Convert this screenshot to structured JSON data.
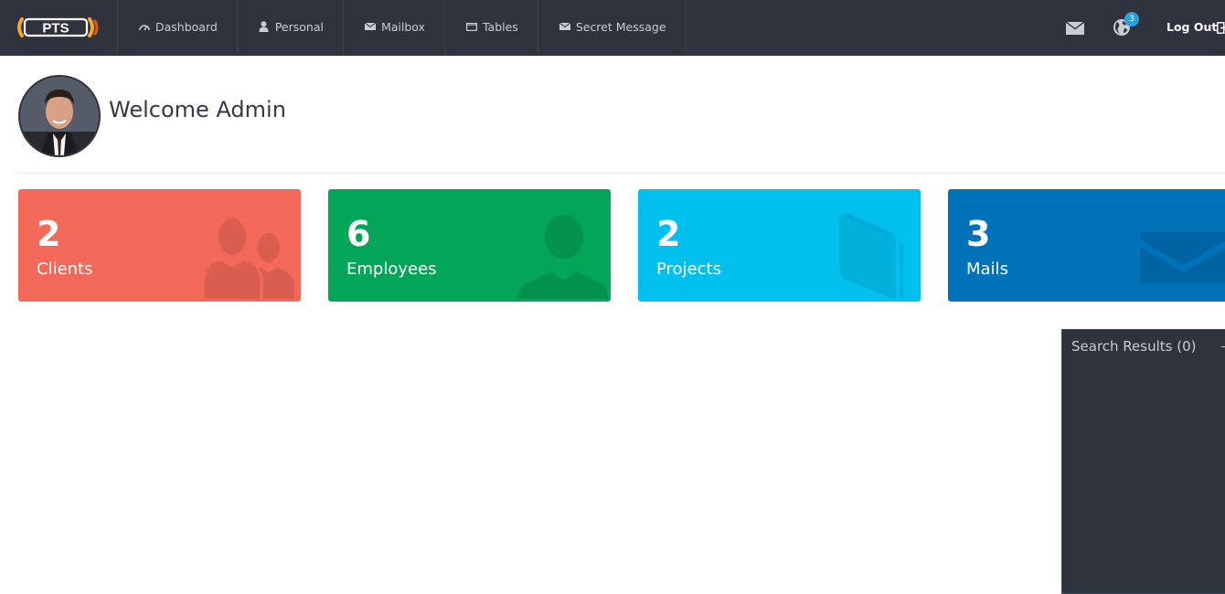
{
  "brand": {
    "logo_text": "PTS"
  },
  "nav": {
    "items": [
      {
        "label": "Dashboard",
        "icon": "dashboard-icon"
      },
      {
        "label": "Personal",
        "icon": "user-icon"
      },
      {
        "label": "Mailbox",
        "icon": "envelope-icon"
      },
      {
        "label": "Tables",
        "icon": "table-icon"
      },
      {
        "label": "Secret Message",
        "icon": "envelope-icon"
      }
    ]
  },
  "toolbar": {
    "notification_count": "3",
    "logout_label": "Log Out"
  },
  "welcome": {
    "text": "Welcome Admin"
  },
  "stats": [
    {
      "count": "2",
      "label": "Clients",
      "color": "#f2695a",
      "icon": "users-icon"
    },
    {
      "count": "6",
      "label": "Employees",
      "color": "#03a659",
      "icon": "user-icon"
    },
    {
      "count": "2",
      "label": "Projects",
      "color": "#02c0ee",
      "icon": "book-icon"
    },
    {
      "count": "3",
      "label": "Mails",
      "color": "#0072ba",
      "icon": "envelope-icon"
    }
  ],
  "search_panel": {
    "title": "Search Results (0)"
  }
}
